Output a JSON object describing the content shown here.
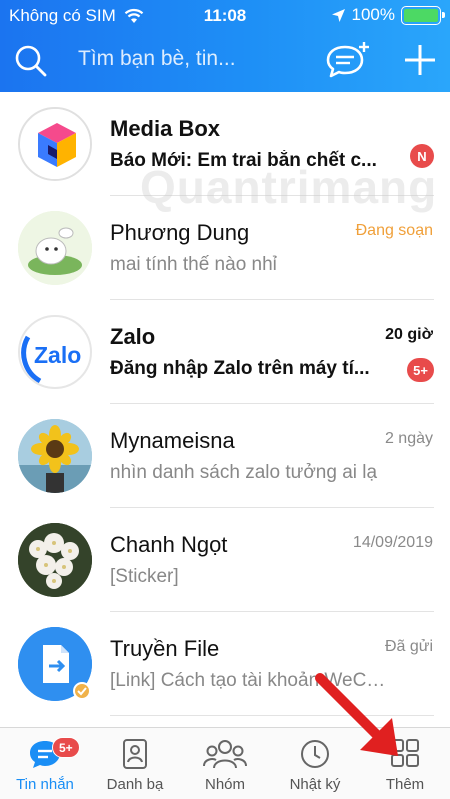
{
  "status_bar": {
    "carrier": "Không có SIM",
    "time": "11:08",
    "battery": "100%"
  },
  "header": {
    "search_placeholder": "Tìm bạn bè, tin...",
    "icons": [
      "search-icon",
      "qr-chat-icon",
      "plus-icon"
    ],
    "colors": {
      "gradient_start": "#1b74f0",
      "gradient_end": "#2aa6fb"
    }
  },
  "watermark": "Quantrimang",
  "conversations": [
    {
      "name": "Media Box",
      "preview": "Báo Mới: Em trai bắn chết c...",
      "meta": "",
      "badge": "N",
      "unread": true
    },
    {
      "name": "Phương Dung",
      "preview": "mai tính thế nào nhỉ",
      "meta": "Đang soạn",
      "badge": "",
      "unread": false
    },
    {
      "name": "Zalo",
      "preview": "Đăng nhập Zalo trên máy tí...",
      "meta": "20 giờ",
      "badge": "5+",
      "unread": true
    },
    {
      "name": "Mynameisna",
      "preview": "nhìn danh sách zalo tưởng ai lạ",
      "meta": "2 ngày",
      "badge": "",
      "unread": false
    },
    {
      "name": "Chanh Ngọt",
      "preview": "[Sticker]",
      "meta": "14/09/2019",
      "badge": "",
      "unread": false
    },
    {
      "name": "Truyền File",
      "preview": "[Link] Cách tạo tài khoản WeChat...",
      "meta": "Đã gửi",
      "badge": "",
      "unread": false
    }
  ],
  "tabs": [
    {
      "label": "Tin nhắn",
      "icon": "chat-icon",
      "badge": "5+",
      "active": true
    },
    {
      "label": "Danh bạ",
      "icon": "contacts-icon",
      "badge": "",
      "active": false
    },
    {
      "label": "Nhóm",
      "icon": "group-icon",
      "badge": "",
      "active": false
    },
    {
      "label": "Nhật ký",
      "icon": "clock-icon",
      "badge": "",
      "active": false
    },
    {
      "label": "Thêm",
      "icon": "grid-icon",
      "badge": "",
      "active": false
    }
  ],
  "colors": {
    "accent": "#1a8ef5",
    "badge": "#e84b4b",
    "composing": "#f0a03a",
    "annotation_arrow": "#e02020"
  }
}
